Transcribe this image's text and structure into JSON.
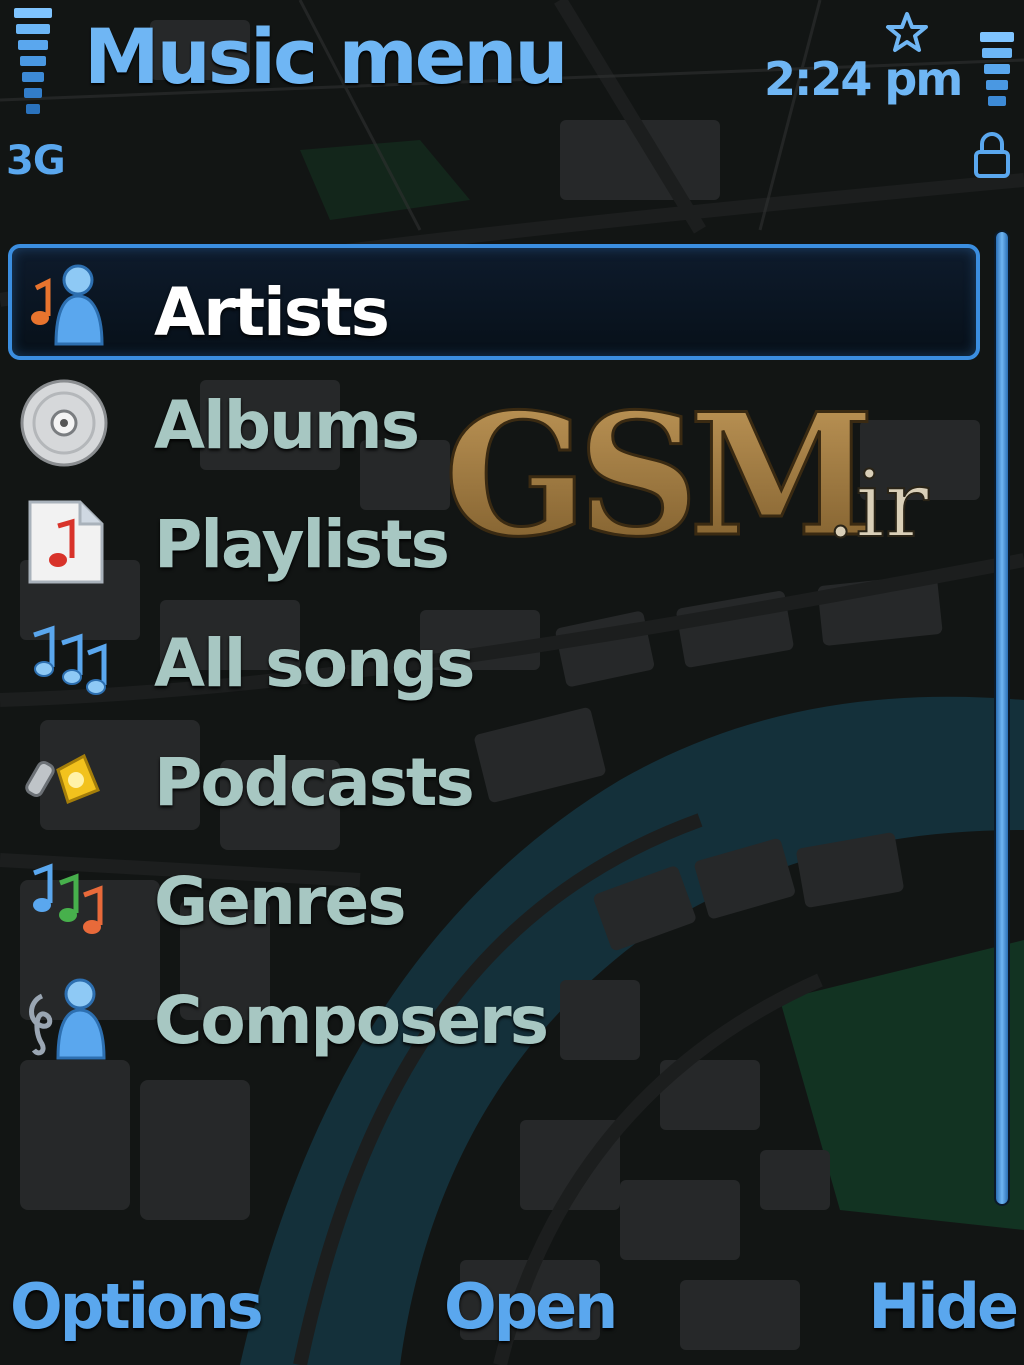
{
  "status_bar": {
    "network_type": "3G",
    "time": "2:24 pm",
    "icons": [
      "signal-strength-icon",
      "profile-star-icon",
      "battery-icon",
      "keypad-lock-icon"
    ]
  },
  "header": {
    "title": "Music menu"
  },
  "menu": {
    "selected_index": 0,
    "items": [
      {
        "label": "Artists",
        "icon": "artist-icon"
      },
      {
        "label": "Albums",
        "icon": "album-disc-icon"
      },
      {
        "label": "Playlists",
        "icon": "playlist-icon"
      },
      {
        "label": "All songs",
        "icon": "songs-notes-icon"
      },
      {
        "label": "Podcasts",
        "icon": "podcast-icon"
      },
      {
        "label": "Genres",
        "icon": "genres-icon"
      },
      {
        "label": "Composers",
        "icon": "composer-icon"
      }
    ]
  },
  "watermark": {
    "brand": "GSM",
    "suffix": ".ir"
  },
  "softkeys": {
    "left": "Options",
    "middle": "Open",
    "right": "Hide"
  },
  "colors": {
    "accent": "#5aa7ee",
    "title": "#6fb6f4",
    "selection_border": "#3b8ee0",
    "item_text": "#a7c7c2",
    "selected_text": "#ffffff"
  }
}
